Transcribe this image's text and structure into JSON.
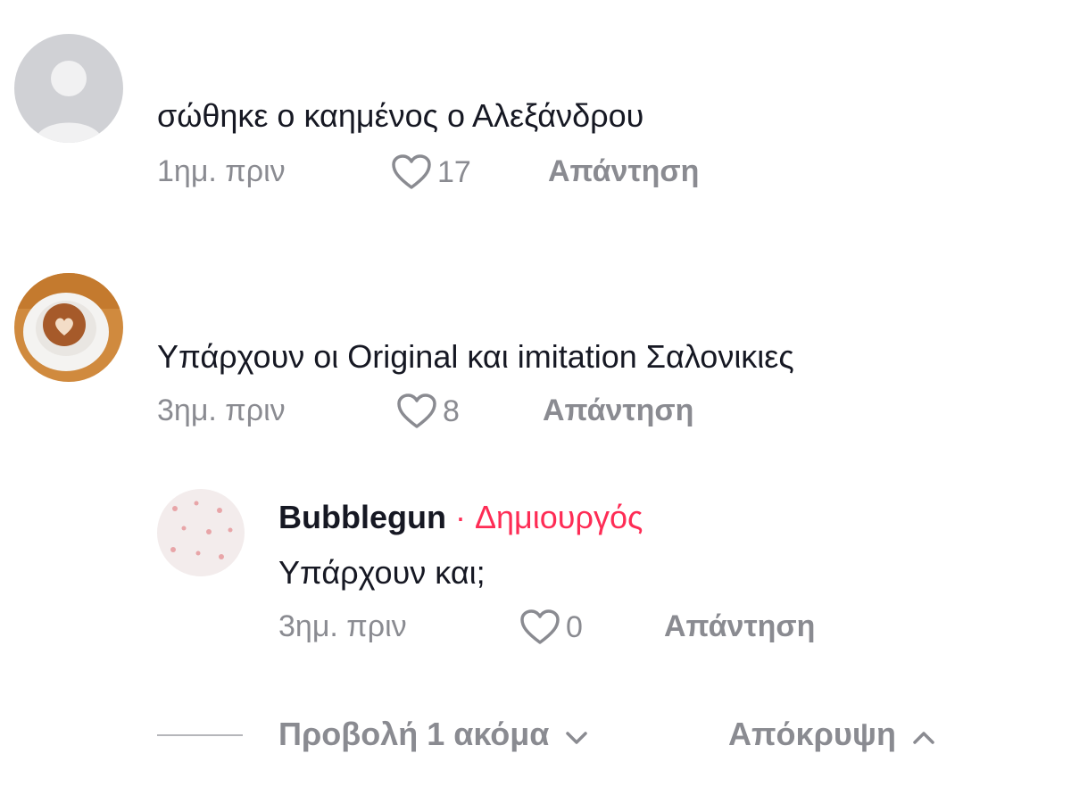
{
  "comments": [
    {
      "username": "",
      "text": "σώθηκε ο καημένος ο Αλεξάνδρου",
      "time": "1ημ. πριν",
      "likes": "17",
      "reply_label": "Απάντηση"
    },
    {
      "username": "",
      "text": "Υπάρχουν οι Original και imitation Σαλονικιες",
      "time": "3ημ. πριν",
      "likes": "8",
      "reply_label": "Απάντηση"
    }
  ],
  "reply": {
    "username": "Bubblegun",
    "creator_badge": "· Δημιουργός",
    "text": "Υπάρχουν και;",
    "time": "3ημ. πριν",
    "likes": "0",
    "reply_label": "Απάντηση"
  },
  "footer": {
    "view_more_label": "Προβολή 1 ακόμα",
    "hide_label": "Απόκρυψη"
  },
  "colors": {
    "text_primary": "#161823",
    "text_secondary": "#8a8b91",
    "creator_accent": "#fe2c55"
  }
}
